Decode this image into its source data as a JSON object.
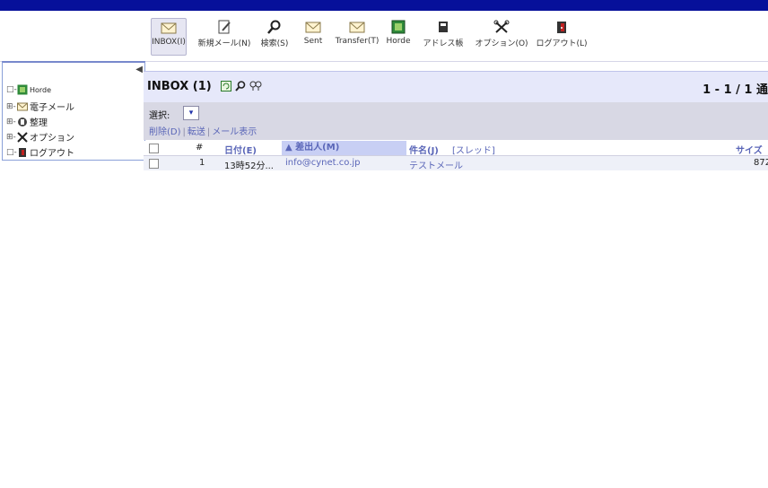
{
  "toolbar": {
    "items": [
      {
        "label": "INBOX(I)",
        "icon": "mail-icon"
      },
      {
        "label": "新規メール(N)",
        "icon": "compose-icon"
      },
      {
        "label": "検索(S)",
        "icon": "search-icon"
      },
      {
        "label": "Sent",
        "icon": "mail-icon"
      },
      {
        "label": "Transfer(T)",
        "icon": "mail-icon"
      },
      {
        "label": "Horde",
        "icon": "horde-icon"
      },
      {
        "label": "アドレス帳",
        "icon": "addressbook-icon"
      },
      {
        "label": "オプション(O)",
        "icon": "options-icon"
      },
      {
        "label": "ログアウト(L)",
        "icon": "logout-icon"
      }
    ]
  },
  "sidebar": {
    "items": [
      {
        "toggle": "□-",
        "label": "Horde",
        "icon": "horde-icon"
      },
      {
        "toggle": "⊞-",
        "label": "電子メール",
        "icon": "mail-icon"
      },
      {
        "toggle": "⊞-",
        "label": "整理",
        "icon": "organize-icon"
      },
      {
        "toggle": "⊞-",
        "label": "オプション",
        "icon": "options-icon"
      },
      {
        "toggle": "□-",
        "label": "ログアウト",
        "icon": "logout-icon"
      }
    ]
  },
  "mailbox": {
    "title": "INBOX (1)",
    "page_count": "1 - 1 / 1 通"
  },
  "actions": {
    "select_label": "選択:",
    "select_value": "▾",
    "delete_label": "削除(D)",
    "forward_label": "転送",
    "show_label": "メール表示"
  },
  "table": {
    "columns": {
      "number": "#",
      "date": "日付(E)",
      "from": "▲ 差出人(M)",
      "subject": "件名(J)",
      "thread": "[スレッド]",
      "size": "サイズ"
    },
    "rows": [
      {
        "number": "1",
        "date": "13時52分...",
        "from": "info@cynet.co.jp",
        "subject": "テストメール",
        "size": "872"
      }
    ]
  }
}
